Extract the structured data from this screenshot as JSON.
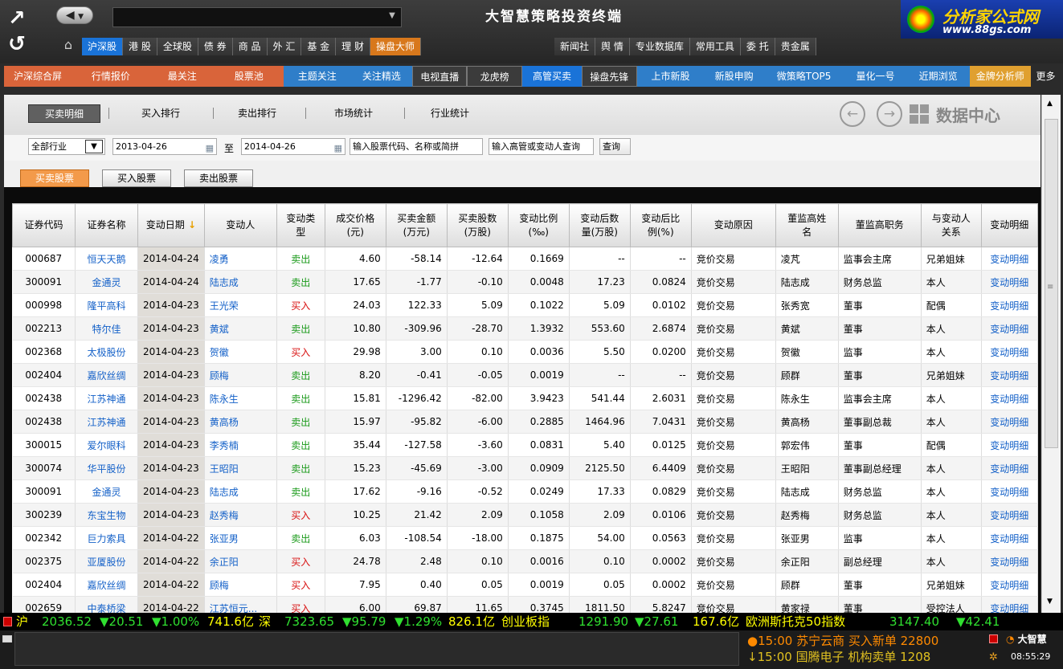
{
  "app": {
    "title": "大智慧策略投资终端",
    "brand_name": "分析家公式网",
    "brand_url": "www.88gs.com",
    "logo_text": "大智慧"
  },
  "menu1": [
    {
      "label": "沪深股",
      "active": true
    },
    {
      "label": "港 股"
    },
    {
      "label": "全球股"
    },
    {
      "label": "债 券"
    },
    {
      "label": "商 品"
    },
    {
      "label": "外 汇"
    },
    {
      "label": "基 金"
    },
    {
      "label": "理 财"
    },
    {
      "label": "操盘大师",
      "orange": true
    }
  ],
  "menu1b": [
    {
      "label": "新闻社"
    },
    {
      "label": "舆 情"
    },
    {
      "label": "专业数据库"
    },
    {
      "label": "常用工具"
    },
    {
      "label": "委 托"
    },
    {
      "label": "贵金属"
    }
  ],
  "menu2": [
    {
      "label": "沪深综合屏",
      "bg": "#d9643a"
    },
    {
      "label": "行情报价",
      "bg": "#d9643a"
    },
    {
      "label": "最关注",
      "bg": "#d9643a"
    },
    {
      "label": "股票池",
      "bg": "#d9643a"
    },
    {
      "label": "主题关注",
      "bg": "#2f7ec9"
    },
    {
      "label": "关注精选",
      "bg": "#2f7ec9"
    },
    {
      "label": "电视直播",
      "bg": "#3b3b3b"
    },
    {
      "label": "龙虎榜",
      "bg": "#3b3b3b"
    },
    {
      "label": "高管买卖",
      "bg": "#1a73d8"
    },
    {
      "label": "操盘先锋",
      "bg": "#3b3b3b"
    },
    {
      "label": "上市新股",
      "bg": "#2f7ec9"
    },
    {
      "label": "新股申购",
      "bg": "#2f7ec9"
    },
    {
      "label": "微策略TOP5",
      "bg": "#2f7ec9"
    },
    {
      "label": "量化一号",
      "bg": "#2f7ec9"
    },
    {
      "label": "近期浏览",
      "bg": "#2f7ec9"
    },
    {
      "label": "金牌分析师",
      "bg": "#e0a030"
    },
    {
      "label": "更多",
      "bg": "#2b2b2b"
    }
  ],
  "subtabs": {
    "t1": "买卖明细",
    "t2": "买入排行",
    "t3": "卖出排行",
    "t4": "市场统计",
    "t5": "行业统计",
    "data_center": "数据中心"
  },
  "filter": {
    "industry": "全部行业",
    "date_from": "2013-04-26",
    "to": "至",
    "date_to": "2014-04-26",
    "code_ph": "输入股票代码、名称或简拼",
    "person_ph": "输入高管或变动人查询",
    "query": "查询"
  },
  "buttons": {
    "b1": "买卖股票",
    "b2": "买入股票",
    "b3": "卖出股票"
  },
  "headers": [
    "证券代码",
    "证券名称",
    "变动日期",
    "变动人",
    "变动类\n型",
    "成交价格\n(元)",
    "买卖金额\n(万元)",
    "买卖股数\n(万股)",
    "变动比例\n(‰)",
    "变动后数\n量(万股)",
    "变动后比\n例(%)",
    "变动原因",
    "董监高姓\n名",
    "董监高职务",
    "与变动人\n关系",
    "变动明细"
  ],
  "rows": [
    [
      "000687",
      "恒天天鹅",
      "2014-04-24",
      "凌勇",
      "卖出",
      "4.60",
      "-58.14",
      "-12.64",
      "0.1669",
      "--",
      "--",
      "竞价交易",
      "凌芃",
      "监事会主席",
      "兄弟姐妹",
      "变动明细"
    ],
    [
      "300091",
      "金通灵",
      "2014-04-24",
      "陆志成",
      "卖出",
      "17.65",
      "-1.77",
      "-0.10",
      "0.0048",
      "17.23",
      "0.0824",
      "竞价交易",
      "陆志成",
      "财务总监",
      "本人",
      "变动明细"
    ],
    [
      "000998",
      "隆平高科",
      "2014-04-23",
      "王光荣",
      "买入",
      "24.03",
      "122.33",
      "5.09",
      "0.1022",
      "5.09",
      "0.0102",
      "竞价交易",
      "张秀宽",
      "董事",
      "配偶",
      "变动明细"
    ],
    [
      "002213",
      "特尔佳",
      "2014-04-23",
      "黄斌",
      "卖出",
      "10.80",
      "-309.96",
      "-28.70",
      "1.3932",
      "553.60",
      "2.6874",
      "竞价交易",
      "黄斌",
      "董事",
      "本人",
      "变动明细"
    ],
    [
      "002368",
      "太极股份",
      "2014-04-23",
      "贺徽",
      "买入",
      "29.98",
      "3.00",
      "0.10",
      "0.0036",
      "5.50",
      "0.0200",
      "竞价交易",
      "贺徽",
      "监事",
      "本人",
      "变动明细"
    ],
    [
      "002404",
      "嘉欣丝绸",
      "2014-04-23",
      "顾梅",
      "卖出",
      "8.20",
      "-0.41",
      "-0.05",
      "0.0019",
      "--",
      "--",
      "竞价交易",
      "顾群",
      "董事",
      "兄弟姐妹",
      "变动明细"
    ],
    [
      "002438",
      "江苏神通",
      "2014-04-23",
      "陈永生",
      "卖出",
      "15.81",
      "-1296.42",
      "-82.00",
      "3.9423",
      "541.44",
      "2.6031",
      "竞价交易",
      "陈永生",
      "监事会主席",
      "本人",
      "变动明细"
    ],
    [
      "002438",
      "江苏神通",
      "2014-04-23",
      "黄高杨",
      "卖出",
      "15.97",
      "-95.82",
      "-6.00",
      "0.2885",
      "1464.96",
      "7.0431",
      "竞价交易",
      "黄高杨",
      "董事副总裁",
      "本人",
      "变动明细"
    ],
    [
      "300015",
      "爱尔眼科",
      "2014-04-23",
      "李秀楠",
      "卖出",
      "35.44",
      "-127.58",
      "-3.60",
      "0.0831",
      "5.40",
      "0.0125",
      "竞价交易",
      "郭宏伟",
      "董事",
      "配偶",
      "变动明细"
    ],
    [
      "300074",
      "华平股份",
      "2014-04-23",
      "王昭阳",
      "卖出",
      "15.23",
      "-45.69",
      "-3.00",
      "0.0909",
      "2125.50",
      "6.4409",
      "竞价交易",
      "王昭阳",
      "董事副总经理",
      "本人",
      "变动明细"
    ],
    [
      "300091",
      "金通灵",
      "2014-04-23",
      "陆志成",
      "卖出",
      "17.62",
      "-9.16",
      "-0.52",
      "0.0249",
      "17.33",
      "0.0829",
      "竞价交易",
      "陆志成",
      "财务总监",
      "本人",
      "变动明细"
    ],
    [
      "300239",
      "东宝生物",
      "2014-04-23",
      "赵秀梅",
      "买入",
      "10.25",
      "21.42",
      "2.09",
      "0.1058",
      "2.09",
      "0.0106",
      "竞价交易",
      "赵秀梅",
      "财务总监",
      "本人",
      "变动明细"
    ],
    [
      "002342",
      "巨力索具",
      "2014-04-22",
      "张亚男",
      "卖出",
      "6.03",
      "-108.54",
      "-18.00",
      "0.1875",
      "54.00",
      "0.0563",
      "竞价交易",
      "张亚男",
      "监事",
      "本人",
      "变动明细"
    ],
    [
      "002375",
      "亚厦股份",
      "2014-04-22",
      "余正阳",
      "买入",
      "24.78",
      "2.48",
      "0.10",
      "0.0016",
      "0.10",
      "0.0002",
      "竞价交易",
      "余正阳",
      "副总经理",
      "本人",
      "变动明细"
    ],
    [
      "002404",
      "嘉欣丝绸",
      "2014-04-22",
      "顾梅",
      "买入",
      "7.95",
      "0.40",
      "0.05",
      "0.0019",
      "0.05",
      "0.0002",
      "竞价交易",
      "顾群",
      "董事",
      "兄弟姐妹",
      "变动明细"
    ],
    [
      "002659",
      "中泰桥梁",
      "2014-04-22",
      "江苏恒元...",
      "买入",
      "6.00",
      "69.87",
      "11.65",
      "0.3745",
      "1811.50",
      "5.8247",
      "竞价交易",
      "黄家禄",
      "董事",
      "受控法人",
      "变动明细"
    ]
  ],
  "ticker": [
    {
      "t": "沪",
      "c": "#ffff00"
    },
    {
      "t": "2036.52",
      "c": "#30e030"
    },
    {
      "t": "▼20.51",
      "c": "#30e030"
    },
    {
      "t": "▼1.00%",
      "c": "#30e030"
    },
    {
      "t": "741.6亿",
      "c": "#ffff00"
    },
    {
      "t": "深",
      "c": "#ffff00"
    },
    {
      "t": "7323.65",
      "c": "#30e030"
    },
    {
      "t": "▼95.79",
      "c": "#30e030"
    },
    {
      "t": "▼1.29%",
      "c": "#30e030"
    },
    {
      "t": "826.1亿",
      "c": "#ffff00"
    },
    {
      "t": "创业板指",
      "c": "#ffff00"
    },
    {
      "t": "1291.90",
      "c": "#30e030"
    },
    {
      "t": "▼27.61",
      "c": "#30e030"
    },
    {
      "t": "167.6亿",
      "c": "#ffff00"
    },
    {
      "t": "欧洲斯托克50指数",
      "c": "#ffff00"
    },
    {
      "t": "3147.40",
      "c": "#30e030"
    },
    {
      "t": "▼42.41",
      "c": "#30e030"
    }
  ],
  "rolling": [
    {
      "t": "●15:00 苏宁云商 买入新单 22800",
      "c": "#ff8a00"
    },
    {
      "t": "↓15:00 国腾电子 机构卖单 1208",
      "c": "#e0c020"
    }
  ],
  "clock": "08:55:29",
  "colors": {
    "buy": "#d81010",
    "sell": "#1a9a1a",
    "link": "#1360c8"
  }
}
